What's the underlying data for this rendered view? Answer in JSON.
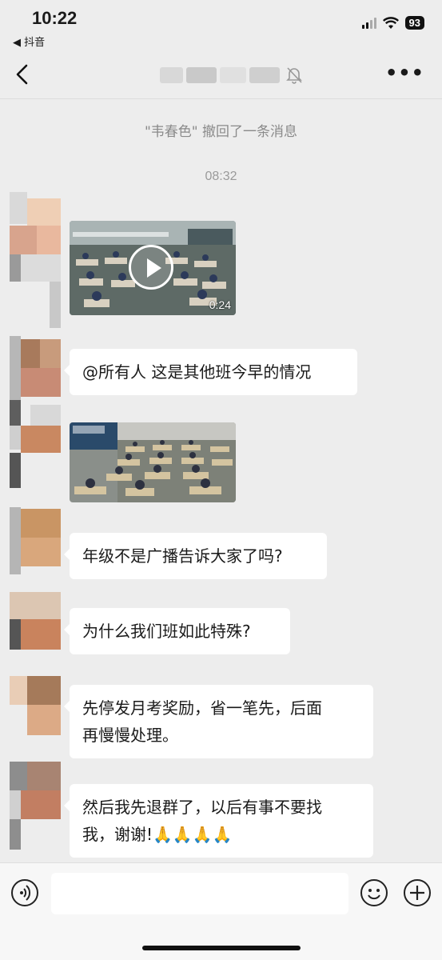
{
  "status_bar": {
    "time": "10:22",
    "back_app": "◀ 抖音",
    "battery": "93"
  },
  "chat": {
    "recall_notice": "\"韦春色\" 撤回了一条消息",
    "timestamp": "08:32",
    "messages": [
      {
        "type": "video",
        "duration": "0:24"
      },
      {
        "type": "text",
        "text": "@所有人 这是其他班今早的情况"
      },
      {
        "type": "image"
      },
      {
        "type": "text",
        "text": "年级不是广播告诉大家了吗?"
      },
      {
        "type": "text",
        "text": "为什么我们班如此特殊?"
      },
      {
        "type": "text",
        "line1": "先停发月考奖励，省一笔先，后面",
        "line2": "再慢慢处理。"
      },
      {
        "type": "text",
        "line1": "然后我先退群了，以后有事不要找",
        "line2": "我，谢谢!",
        "emoji": "🙏🙏🙏🙏"
      }
    ]
  },
  "icons": {
    "back": "chevron-left-icon",
    "mute": "bell-slash-icon",
    "more": "more-dots-icon",
    "voice": "voice-icon",
    "emoji": "smiley-icon",
    "plus": "plus-circle-icon"
  },
  "colors": {
    "background": "#ededed",
    "bubble": "#ffffff",
    "input_bar": "#f7f7f7"
  }
}
